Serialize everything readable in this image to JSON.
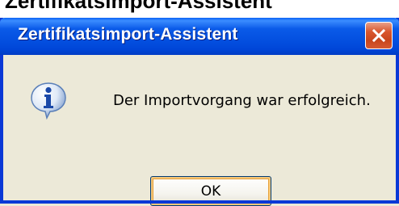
{
  "background_window": {
    "partial_title": "Zertifikatsimport-Assistent"
  },
  "dialog": {
    "title": "Zertifikatsimport-Assistent",
    "message": "Der Importvorgang war erfolgreich.",
    "icon": "info-icon",
    "ok_label": "OK",
    "close_icon": "close-icon"
  },
  "colors": {
    "titlebar": "#0a5ae8",
    "dialog_bg": "#ece9d8",
    "close_button": "#d9572e",
    "frame": "#0a38d6"
  }
}
